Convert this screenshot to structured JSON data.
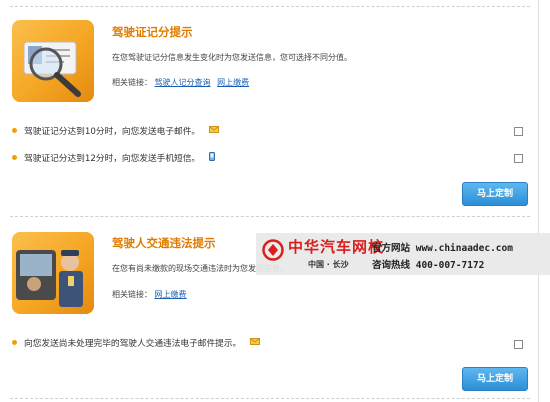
{
  "section1": {
    "title": "驾驶证记分提示",
    "desc": "在您驾驶证记分信息发生变化时为您发送信息，您可选择不同分值。",
    "links_label": "相关链接：",
    "link1": "驾驶人记分查询",
    "link2": "网上缴费",
    "opt1": "驾驶证记分达到10分时，向您发送电子邮件。",
    "opt2": "驾驶证记分达到12分时，向您发送手机短信。",
    "button": "马上定制"
  },
  "section2": {
    "title": "驾驶人交通违法提示",
    "desc": "在您有尚未缴款的现场交通违法时为您发送信息。",
    "links_label": "相关链接：",
    "link1": "网上缴费",
    "opt1": "向您发送尚未处理完毕的驾驶人交通违法电子邮件提示。",
    "button": "马上定制"
  },
  "watermark": {
    "brand": "中华汽车网校",
    "city": "中国 · 长沙",
    "line1": "官方网站 www.chinaadec.com",
    "line2": "咨询热线 400-007-7172"
  },
  "colors": {
    "accent": "#e07b00",
    "link": "#1a5fb4",
    "button": "#2b8fd8",
    "brand": "#d91e1e"
  },
  "icons": [
    "license-magnifier-icon",
    "police-car-icon",
    "email-icon",
    "phone-icon",
    "checkbox"
  ]
}
